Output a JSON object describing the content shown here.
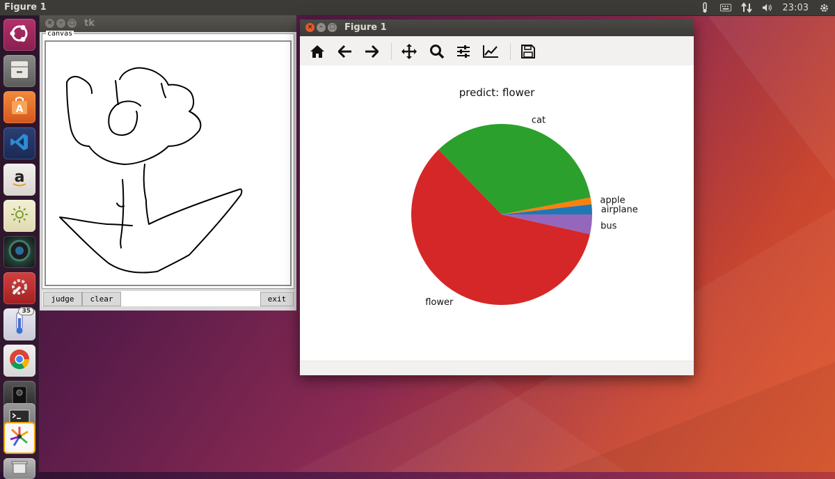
{
  "top_panel": {
    "title": "Figure 1",
    "clock": "23:03"
  },
  "launcher": {
    "badge_count": "35"
  },
  "tk_window": {
    "title": "tk",
    "canvas_label": "canvas",
    "buttons": {
      "judge": "judge",
      "clear": "clear",
      "exit": "exit"
    }
  },
  "figure_window": {
    "title": "Figure 1",
    "toolbar_icons": [
      "home-icon",
      "back-arrow-icon",
      "forward-arrow-icon",
      "pan-icon",
      "zoom-icon",
      "configure-subplots-icon",
      "edit-axes-icon",
      "save-icon"
    ]
  },
  "chart_data": {
    "type": "pie",
    "title": "predict: flower",
    "slices": [
      {
        "label": "airplane",
        "value": 1.8,
        "color": "#1f77b4"
      },
      {
        "label": "apple",
        "value": 1.2,
        "color": "#ff7f0e"
      },
      {
        "label": "cat",
        "value": 34.3,
        "color": "#2ca02c"
      },
      {
        "label": "flower",
        "value": 59.2,
        "color": "#d62728"
      },
      {
        "label": "bus",
        "value": 3.5,
        "color": "#9467bd"
      }
    ],
    "start_angle_deg": 0,
    "direction": "counterclockwise"
  }
}
